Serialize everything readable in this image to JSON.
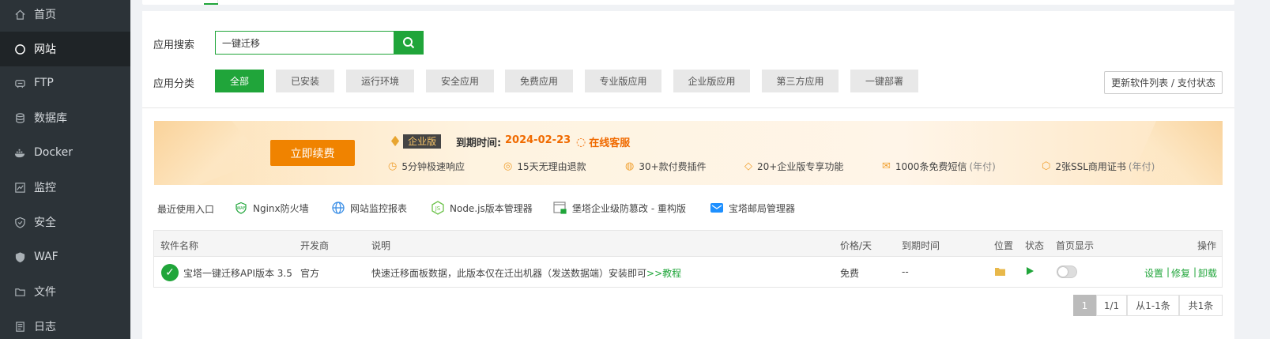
{
  "sidebar": {
    "items": [
      {
        "label": "首页",
        "icon": "home-icon"
      },
      {
        "label": "网站",
        "icon": "globe-icon",
        "active": true
      },
      {
        "label": "FTP",
        "icon": "ftp-icon"
      },
      {
        "label": "数据库",
        "icon": "database-icon"
      },
      {
        "label": "Docker",
        "icon": "docker-icon"
      },
      {
        "label": "监控",
        "icon": "monitor-icon"
      },
      {
        "label": "安全",
        "icon": "shield-icon"
      },
      {
        "label": "WAF",
        "icon": "waf-icon"
      },
      {
        "label": "文件",
        "icon": "folder-icon"
      },
      {
        "label": "日志",
        "icon": "log-icon"
      }
    ]
  },
  "search": {
    "label": "应用搜索",
    "value": "一键迁移"
  },
  "category": {
    "label": "应用分类",
    "items": [
      "全部",
      "已安装",
      "运行环境",
      "安全应用",
      "免费应用",
      "专业版应用",
      "企业版应用",
      "第三方应用",
      "一键部署"
    ],
    "active_index": 0
  },
  "update_button": "更新软件列表 / 支付状态",
  "banner": {
    "renew_label": "立即续费",
    "edition": "企业版",
    "expire_label": "到期时间:",
    "expire_date": "2024-02-23",
    "support": "在线客服",
    "features": [
      {
        "text": "5分钟极速响应",
        "icon": "clock-icon"
      },
      {
        "text": "15天无理由退款",
        "icon": "refund-icon"
      },
      {
        "text": "30+款付费插件",
        "icon": "plugin-icon"
      },
      {
        "text": "20+企业版专享功能",
        "icon": "diamond-icon"
      },
      {
        "text": "1000条免费短信",
        "sub": "(年付)",
        "icon": "mail-icon"
      },
      {
        "text": "2张SSL商用证书",
        "sub": "(年付)",
        "icon": "ssl-icon"
      }
    ]
  },
  "recent": {
    "label": "最近使用入口",
    "items": [
      {
        "text": "Nginx防火墙",
        "icon": "waf-shield-icon"
      },
      {
        "text": "网站监控报表",
        "icon": "globe-report-icon"
      },
      {
        "text": "Node.js版本管理器",
        "icon": "nodejs-icon"
      },
      {
        "text": "堡塔企业级防篡改 - 重构版",
        "icon": "lock-window-icon"
      },
      {
        "text": "宝塔邮局管理器",
        "icon": "mail-manager-icon"
      }
    ]
  },
  "table": {
    "headers": [
      "软件名称",
      "开发商",
      "说明",
      "价格/天",
      "到期时间",
      "位置",
      "状态",
      "首页显示",
      "操作"
    ],
    "rows": [
      {
        "name": "宝塔一键迁移API版本 3.5",
        "vendor": "官方",
        "desc": "快速迁移面板数据，此版本仅在迁出机器（发送数据端）安装即可",
        "desc_link": ">>教程",
        "price": "免费",
        "expire": "--",
        "actions": [
          "设置",
          "修复",
          "卸载"
        ]
      }
    ]
  },
  "pagination": {
    "current": "1",
    "pages": "1/1",
    "range": "从1-1条",
    "total": "共1条"
  },
  "colors": {
    "accent": "#20a53a",
    "orange": "#f08300",
    "sidebar": "#2c3338"
  }
}
